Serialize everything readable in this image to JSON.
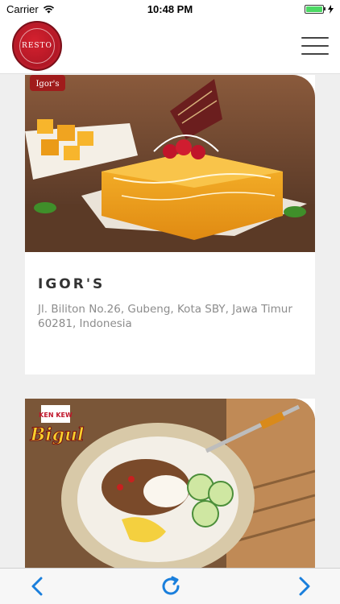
{
  "status_bar": {
    "carrier": "Carrier",
    "time": "10:48 PM",
    "battery_percent": 100
  },
  "header": {
    "logo_text": "RESTO",
    "menu_icon": "hamburger-menu-icon"
  },
  "restaurants": [
    {
      "name": "IGOR'S",
      "address": "Jl. Biliton No.26, Gubeng, Kota SBY, Jawa Timur 60281, Indonesia",
      "image_badge": "Igor's"
    },
    {
      "name": "",
      "address": "",
      "image_badge": "KEN KEW Bigul KITCHEN"
    }
  ],
  "toolbar": {
    "back_icon": "chevron-left-icon",
    "reload_icon": "refresh-icon",
    "forward_icon": "chevron-right-icon"
  },
  "colors": {
    "accent": "#1a7fdc",
    "logo_red": "#c41e2b",
    "cake_orange": "#f2a21c"
  }
}
